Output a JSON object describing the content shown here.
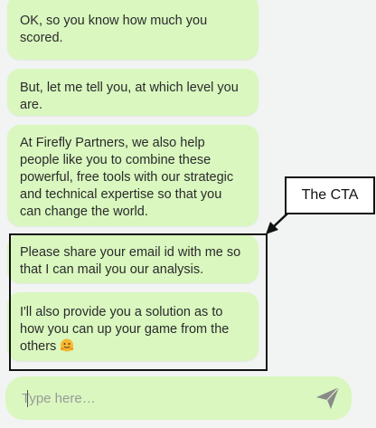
{
  "messages": [
    {
      "text": "OK, so you know how much you scored."
    },
    {
      "text": "But, let me tell you, at which level you are."
    },
    {
      "text": "At Firefly Partners, we also help people like you to combine these powerful, free tools with our strategic and technical expertise so that you can change the world."
    },
    {
      "text": "Please share your email id with me so that I can mail you our analysis."
    },
    {
      "text": "I'll also provide you a solution as to how you can up your game from the others",
      "emoji": "hugging-face-emoji"
    }
  ],
  "annotation": {
    "label": "The CTA"
  },
  "composer": {
    "placeholder": "Type here…",
    "value": "",
    "send_icon": "send-icon"
  },
  "colors": {
    "bubble": "#d9f7bf",
    "background": "#f2f3f3",
    "annotation": "#111111"
  }
}
